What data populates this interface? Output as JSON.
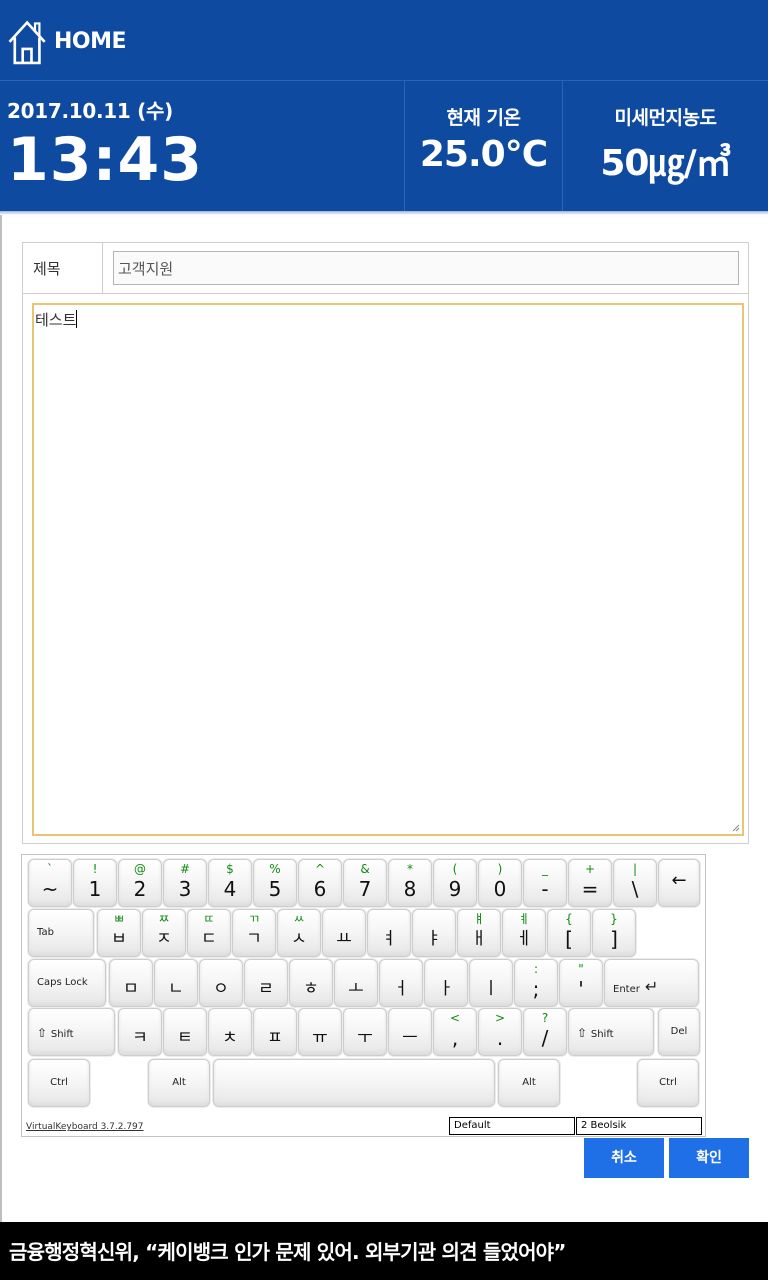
{
  "header": {
    "home_label": "HOME",
    "date": "2017.10.11 (수)",
    "time": "13:43",
    "temperature": {
      "label": "현재 기온",
      "value": "25.0°C"
    },
    "fine_dust": {
      "label": "미세먼지농도",
      "value": "50㎍/㎥"
    }
  },
  "form": {
    "subject_label": "제목",
    "subject_value": "고객지원",
    "body_value": "테스트"
  },
  "keyboard": {
    "rows": [
      [
        {
          "id": "grave",
          "shift": "`",
          "main": "~"
        },
        {
          "id": "1",
          "shift": "!",
          "main": "1"
        },
        {
          "id": "2",
          "shift": "@",
          "main": "2"
        },
        {
          "id": "3",
          "shift": "#",
          "main": "3"
        },
        {
          "id": "4",
          "shift": "$",
          "main": "4"
        },
        {
          "id": "5",
          "shift": "%",
          "main": "5"
        },
        {
          "id": "6",
          "shift": "^",
          "main": "6"
        },
        {
          "id": "7",
          "shift": "&",
          "main": "7"
        },
        {
          "id": "8",
          "shift": "*",
          "main": "8"
        },
        {
          "id": "9",
          "shift": "(",
          "main": "9"
        },
        {
          "id": "0",
          "shift": ")",
          "main": "0"
        },
        {
          "id": "minus",
          "shift": "_",
          "main": "-"
        },
        {
          "id": "equals",
          "shift": "+",
          "main": "="
        },
        {
          "id": "backslash",
          "shift": "|",
          "main": "\\"
        },
        {
          "id": "backspace",
          "main": "←",
          "special": true
        }
      ],
      [
        {
          "id": "tab",
          "label": "Tab"
        },
        {
          "id": "q",
          "shift": "ㅃ",
          "main": "ㅂ"
        },
        {
          "id": "w",
          "shift": "ㅉ",
          "main": "ㅈ"
        },
        {
          "id": "e",
          "shift": "ㄸ",
          "main": "ㄷ"
        },
        {
          "id": "r",
          "shift": "ㄲ",
          "main": "ㄱ"
        },
        {
          "id": "t",
          "shift": "ㅆ",
          "main": "ㅅ"
        },
        {
          "id": "y",
          "main": "ㅛ"
        },
        {
          "id": "u",
          "main": "ㅕ"
        },
        {
          "id": "i",
          "main": "ㅑ"
        },
        {
          "id": "o",
          "shift": "ㅒ",
          "main": "ㅐ"
        },
        {
          "id": "p",
          "shift": "ㅖ",
          "main": "ㅔ"
        },
        {
          "id": "lbracket",
          "shift": "{",
          "main": "["
        },
        {
          "id": "rbracket",
          "shift": "}",
          "main": "]"
        }
      ],
      [
        {
          "id": "capslock",
          "label": "Caps Lock"
        },
        {
          "id": "a",
          "main": "ㅁ"
        },
        {
          "id": "s",
          "main": "ㄴ"
        },
        {
          "id": "d",
          "main": "ㅇ"
        },
        {
          "id": "f",
          "main": "ㄹ"
        },
        {
          "id": "g",
          "main": "ㅎ"
        },
        {
          "id": "h",
          "main": "ㅗ"
        },
        {
          "id": "j",
          "main": "ㅓ"
        },
        {
          "id": "k",
          "main": "ㅏ"
        },
        {
          "id": "l",
          "main": "ㅣ"
        },
        {
          "id": "semicolon",
          "shift": ":",
          "main": ";"
        },
        {
          "id": "quote",
          "shift": "\"",
          "main": "'"
        },
        {
          "id": "enter",
          "label": "Enter"
        }
      ],
      [
        {
          "id": "lshift",
          "label": "Shift"
        },
        {
          "id": "z",
          "main": "ㅋ"
        },
        {
          "id": "x",
          "main": "ㅌ"
        },
        {
          "id": "c",
          "main": "ㅊ"
        },
        {
          "id": "v",
          "main": "ㅍ"
        },
        {
          "id": "b",
          "main": "ㅠ"
        },
        {
          "id": "n",
          "main": "ㅜ"
        },
        {
          "id": "m",
          "main": "ㅡ"
        },
        {
          "id": "comma",
          "shift": "<",
          "main": ","
        },
        {
          "id": "period",
          "shift": ">",
          "main": "."
        },
        {
          "id": "slash",
          "shift": "?",
          "main": "/"
        },
        {
          "id": "rshift",
          "label": "Shift"
        },
        {
          "id": "del",
          "label": "Del"
        }
      ],
      [
        {
          "id": "lctrl",
          "label": "Ctrl"
        },
        {
          "id": "lalt",
          "label": "Alt"
        },
        {
          "id": "space",
          "label": ""
        },
        {
          "id": "ralt",
          "label": "Alt"
        },
        {
          "id": "rctrl",
          "label": "Ctrl"
        }
      ]
    ],
    "version_link": "VirtualKeyboard 3.7.2.797",
    "layout_select": "Default",
    "ime_select": "2 Beolsik"
  },
  "buttons": {
    "cancel": "취소",
    "confirm": "확인"
  },
  "caption": "금융행정혁신위, “케이뱅크 인가 문제 있어. 외부기관 의견 들었어야”"
}
